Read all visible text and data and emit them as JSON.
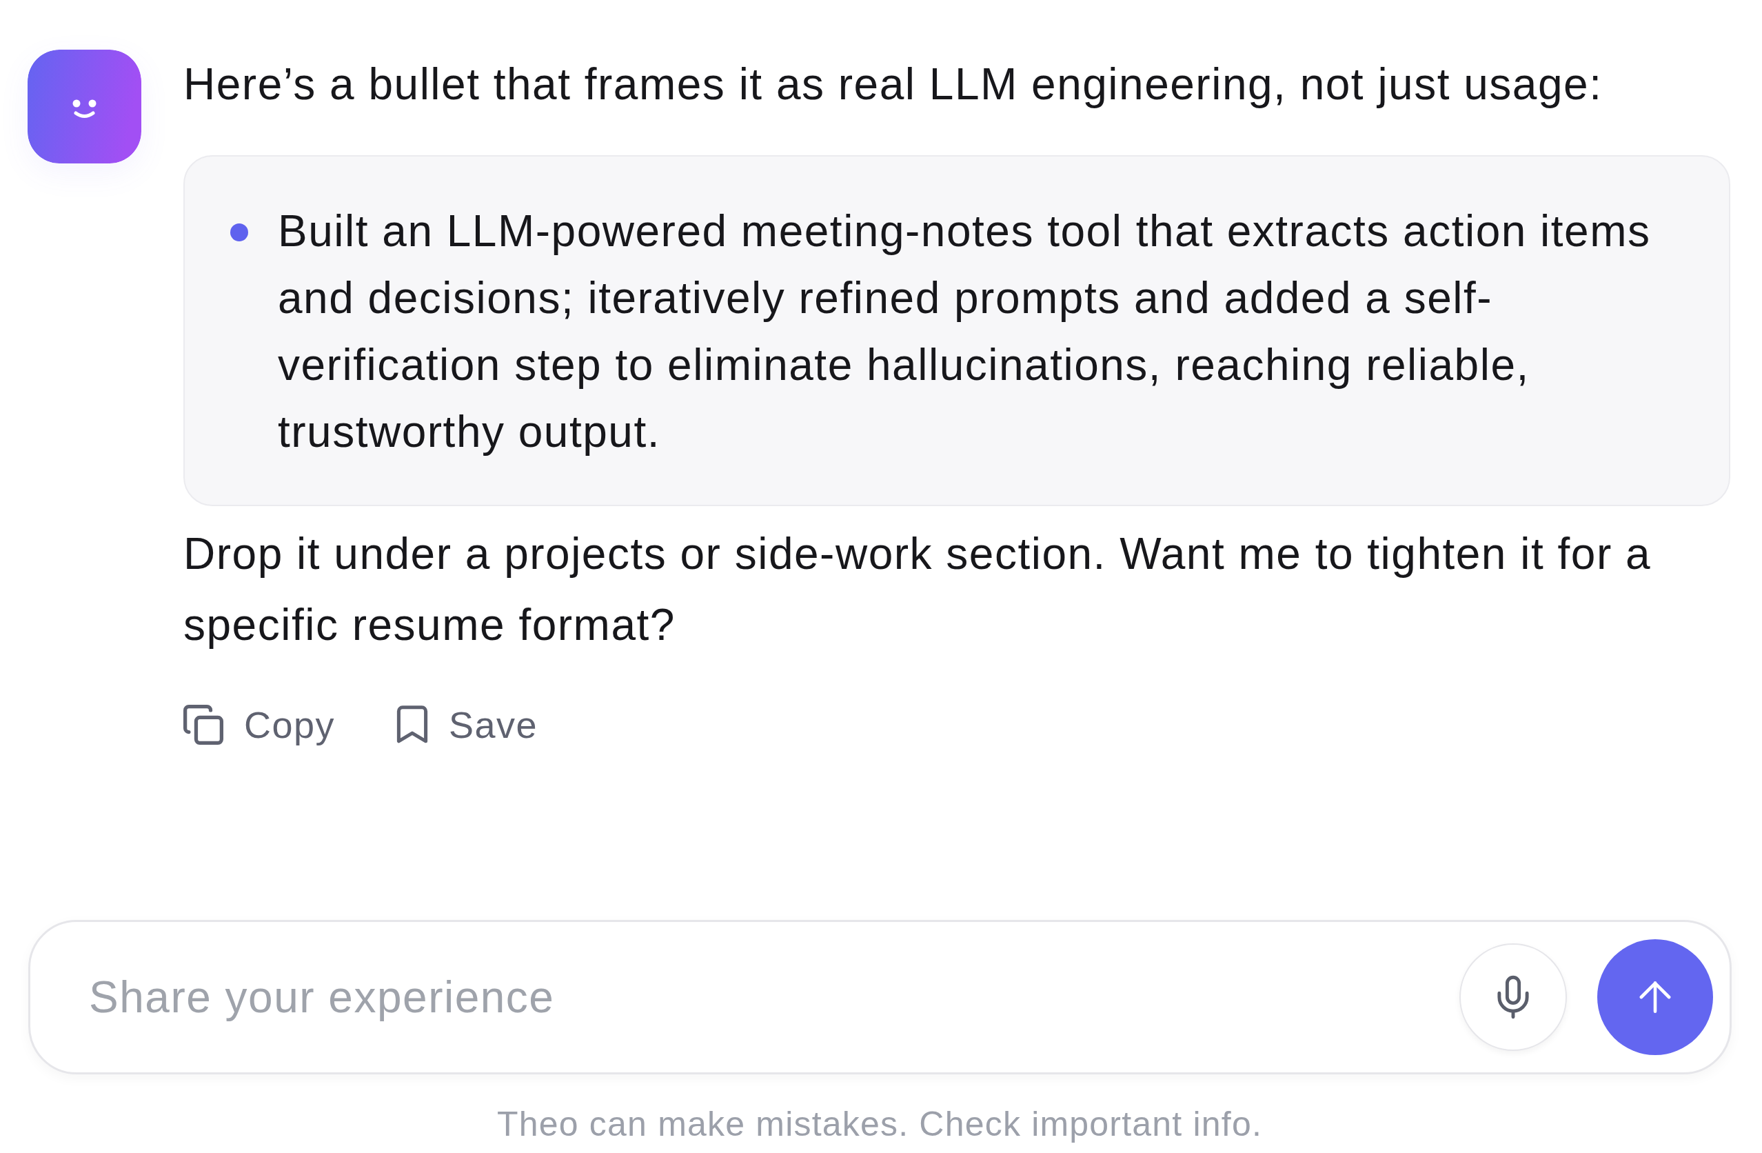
{
  "message": {
    "intro": "Here’s a bullet that frames it as real LLM engineering, not just usage:",
    "bullets": [
      "Built an LLM-powered meeting-notes tool that extracts action items and decisions; iteratively refined prompts and added a self-verification step to eliminate hallucinations, reaching reliable, trustworthy output."
    ],
    "followup": "Drop it under a projects or side-work section. Want me to tighten it for a specific resume format?",
    "actions": [
      {
        "kind": "copy",
        "label": "Copy"
      },
      {
        "kind": "save",
        "label": "Save"
      }
    ]
  },
  "composer": {
    "placeholder": "Share your experience"
  },
  "disclaimer": "Theo can make mistakes. Check important info."
}
